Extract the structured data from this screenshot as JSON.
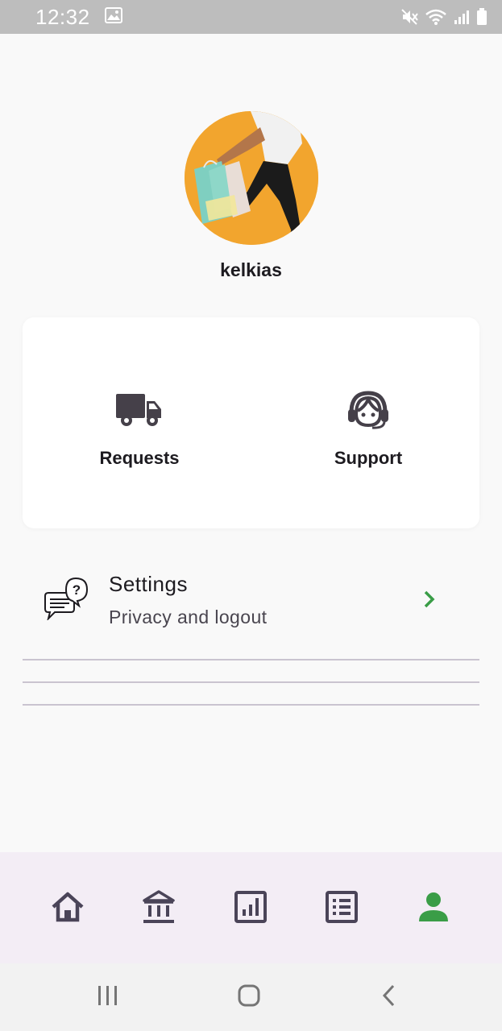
{
  "status_bar": {
    "time": "12:32",
    "icons": [
      "image-icon",
      "mute-icon",
      "wifi-icon",
      "signal-icon",
      "battery-icon"
    ]
  },
  "profile": {
    "username": "kelkias",
    "avatar_bg": "#f2a52e"
  },
  "quick_actions": [
    {
      "label": "Requests",
      "icon": "truck-icon"
    },
    {
      "label": "Support",
      "icon": "headset-agent-icon"
    }
  ],
  "settings": {
    "title": "Settings",
    "subtitle": "Privacy and logout",
    "icon": "chat-question-icon",
    "chevron_color": "#3a9d47"
  },
  "bottom_nav": {
    "items": [
      "home-icon",
      "bank-icon",
      "chart-icon",
      "list-icon",
      "person-icon"
    ],
    "active": "person-icon",
    "active_color": "#3a9d47",
    "inactive_color": "#4a4458"
  },
  "system_nav": [
    "recents-icon",
    "home-circle-icon",
    "back-icon"
  ]
}
